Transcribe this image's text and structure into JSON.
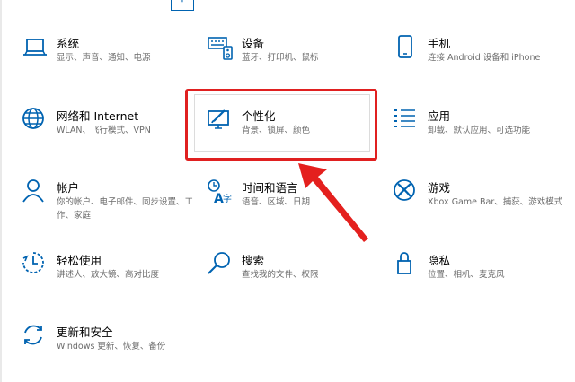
{
  "tiles": [
    {
      "title": "系统",
      "desc": "显示、声音、通知、电源",
      "icon": "laptop-icon"
    },
    {
      "title": "设备",
      "desc": "蓝牙、打印机、鼠标",
      "icon": "keyboard-icon"
    },
    {
      "title": "手机",
      "desc": "连接 Android 设备和 iPhone",
      "icon": "phone-icon"
    },
    {
      "title": "网络和 Internet",
      "desc": "WLAN、飞行模式、VPN",
      "icon": "globe-icon"
    },
    {
      "title": "个性化",
      "desc": "背景、锁屏、颜色",
      "icon": "personalize-icon"
    },
    {
      "title": "应用",
      "desc": "卸载、默认应用、可选功能",
      "icon": "apps-icon"
    },
    {
      "title": "帐户",
      "desc": "你的帐户、电子邮件、同步设置、工作、家庭",
      "icon": "person-icon"
    },
    {
      "title": "时间和语言",
      "desc": "语音、区域、日期",
      "icon": "time-language-icon"
    },
    {
      "title": "游戏",
      "desc": "Xbox Game Bar、捕获、游戏模式",
      "icon": "xbox-icon"
    },
    {
      "title": "轻松使用",
      "desc": "讲述人、放大镜、高对比度",
      "icon": "ease-of-access-icon"
    },
    {
      "title": "搜索",
      "desc": "查找我的文件、权限",
      "icon": "search-icon"
    },
    {
      "title": "隐私",
      "desc": "位置、相机、麦克风",
      "icon": "lock-icon"
    },
    {
      "title": "更新和安全",
      "desc": "Windows 更新、恢复、备份",
      "icon": "update-icon"
    }
  ],
  "top_partial_icon": "中",
  "colors": {
    "accent": "#0063b1",
    "highlight": "#e02020"
  }
}
